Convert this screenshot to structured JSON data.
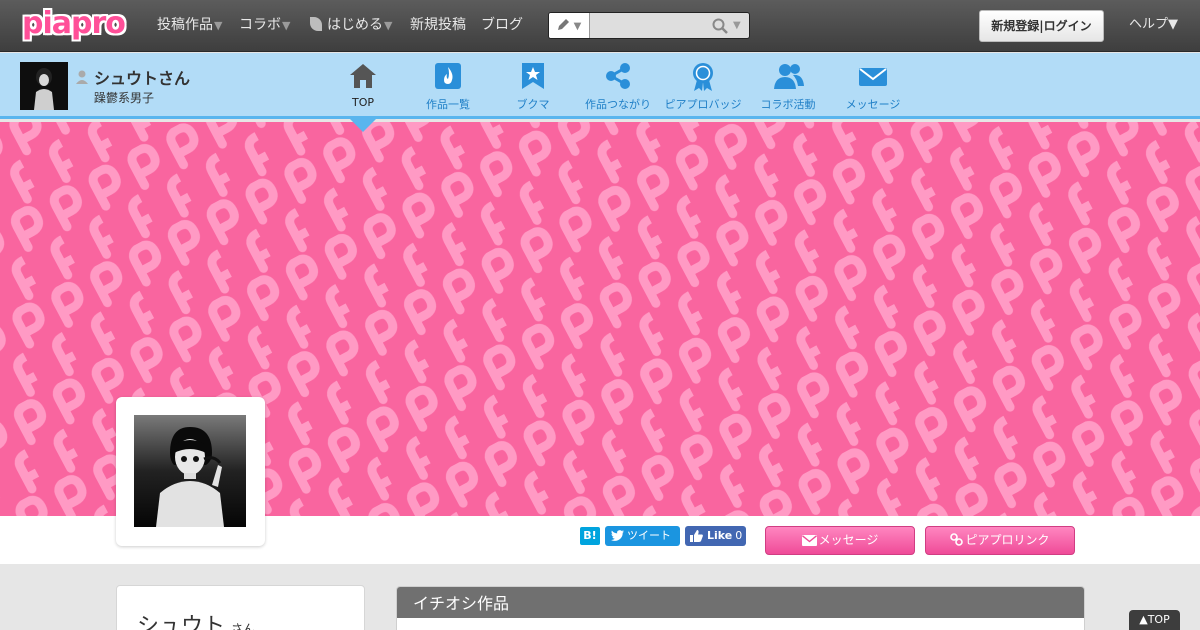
{
  "global_nav": {
    "logo_text": "piapro",
    "items": [
      {
        "label": "投稿作品",
        "dropdown": true
      },
      {
        "label": "コラボ",
        "dropdown": true
      },
      {
        "label": "はじめる",
        "dropdown": true,
        "icon": "leaf-icon"
      },
      {
        "label": "新規投稿",
        "dropdown": false
      },
      {
        "label": "ブログ",
        "dropdown": false
      }
    ],
    "caret": "▼",
    "search": {
      "type_icon": "pencil-icon",
      "type_caret": "▼",
      "value": "",
      "placeholder": "",
      "options_caret": "▼"
    },
    "login_label": "新規登録|ログイン",
    "help_label": "ヘルプ▼"
  },
  "user_nav": {
    "name": "シュウトさん",
    "subtitle": "躁鬱系男子",
    "items": [
      {
        "label": "TOP",
        "icon": "house-icon",
        "active": true
      },
      {
        "label": "作品一覧",
        "icon": "flame-icon",
        "active": false
      },
      {
        "label": "ブクマ",
        "icon": "bookmark-star-icon",
        "active": false
      },
      {
        "label": "作品つながり",
        "icon": "share-icon",
        "active": false
      },
      {
        "label": "ピアプロバッジ",
        "icon": "badge-icon",
        "active": false
      },
      {
        "label": "コラボ活動",
        "icon": "people-icon",
        "active": false
      },
      {
        "label": "メッセージ",
        "icon": "envelope-icon",
        "active": false
      }
    ]
  },
  "colors": {
    "cover_pink": "#f9659f",
    "nav_blue": "#b2dcf7",
    "accent_blue": "#59b5ee",
    "button_pink": "#ef4b98"
  },
  "social": {
    "hatena_label": "B!",
    "tweet_label": "ツイート",
    "like_label": "Like",
    "like_count": "0"
  },
  "actions": {
    "message_label": "メッセージ",
    "piapro_link_label": "ピアプロリンク"
  },
  "sidebar": {
    "name": "シュウト",
    "suffix": "さん"
  },
  "main": {
    "pick_title": "イチオシ作品"
  },
  "to_top_label": "▲TOP"
}
